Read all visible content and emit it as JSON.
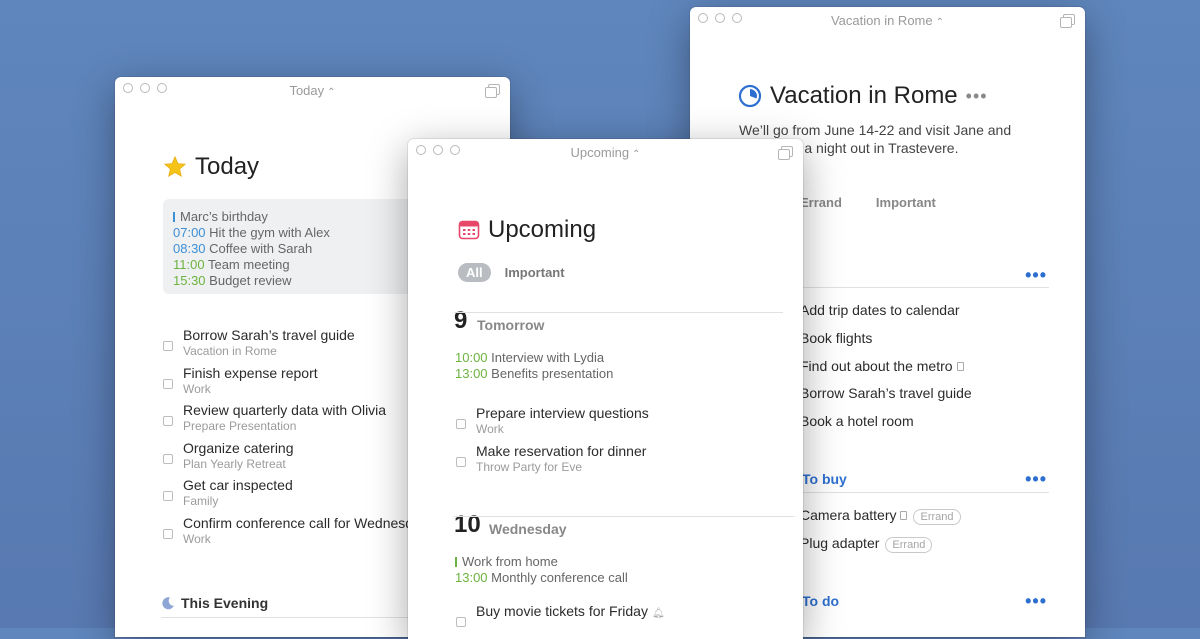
{
  "rome": {
    "window_title": "Vacation in Rome",
    "title": "Vacation in Rome",
    "notes": "We’ll go from June 14-22 and visit Jane and maybe do a night out in Trastevere.",
    "tags": [
      "Errand",
      "Important"
    ],
    "items_group1": [
      "Add trip dates to calendar",
      "Book flights",
      "Find out about the metro",
      "Borrow Sarah’s travel guide",
      "Book a hotel room"
    ],
    "heading_buy": "To buy",
    "items_buy": [
      {
        "title": "Camera battery",
        "tag": "Errand"
      },
      {
        "title": "Plug adapter",
        "tag": "Errand"
      }
    ],
    "heading_do": "To do"
  },
  "today": {
    "window_title": "Today",
    "title": "Today",
    "calendar": [
      {
        "time": "",
        "text": "Marc’s birthday",
        "color": "#3d8fd6"
      },
      {
        "time": "07:00",
        "text": "Hit the gym with Alex",
        "color": "#3d8fd6"
      },
      {
        "time": "08:30",
        "text": "Coffee with Sarah",
        "color": "#3d8fd6"
      },
      {
        "time": "11:00",
        "text": "Team meeting",
        "color": "#6db33f"
      },
      {
        "time": "15:30",
        "text": "Budget review",
        "color": "#6db33f"
      }
    ],
    "todos": [
      {
        "title": "Borrow Sarah’s travel guide",
        "project": "Vacation in Rome"
      },
      {
        "title": "Finish expense report",
        "project": "Work"
      },
      {
        "title": "Review quarterly data with Olivia",
        "project": "Prepare Presentation"
      },
      {
        "title": "Organize catering",
        "project": "Plan Yearly Retreat"
      },
      {
        "title": "Get car inspected",
        "project": "Family"
      },
      {
        "title": "Confirm conference call for Wednesday",
        "project": "Work"
      }
    ],
    "evening": "This Evening"
  },
  "upcoming": {
    "window_title": "Upcoming",
    "title": "Upcoming",
    "filters": [
      "All",
      "Important"
    ],
    "day1": {
      "num": "9",
      "name": "Tomorrow",
      "events": [
        {
          "time": "10:00",
          "text": "Interview with Lydia"
        },
        {
          "time": "13:00",
          "text": "Benefits presentation"
        }
      ],
      "todos": [
        {
          "title": "Prepare interview questions",
          "project": "Work"
        },
        {
          "title": "Make reservation for dinner",
          "project": "Throw Party for Eve"
        }
      ]
    },
    "day2": {
      "num": "10",
      "name": "Wednesday",
      "events": [
        {
          "time": "",
          "text": "Work from home"
        },
        {
          "time": "13:00",
          "text": "Monthly conference call"
        }
      ],
      "todos": [
        {
          "title": "Buy movie tickets for Friday",
          "project": ""
        }
      ]
    }
  }
}
